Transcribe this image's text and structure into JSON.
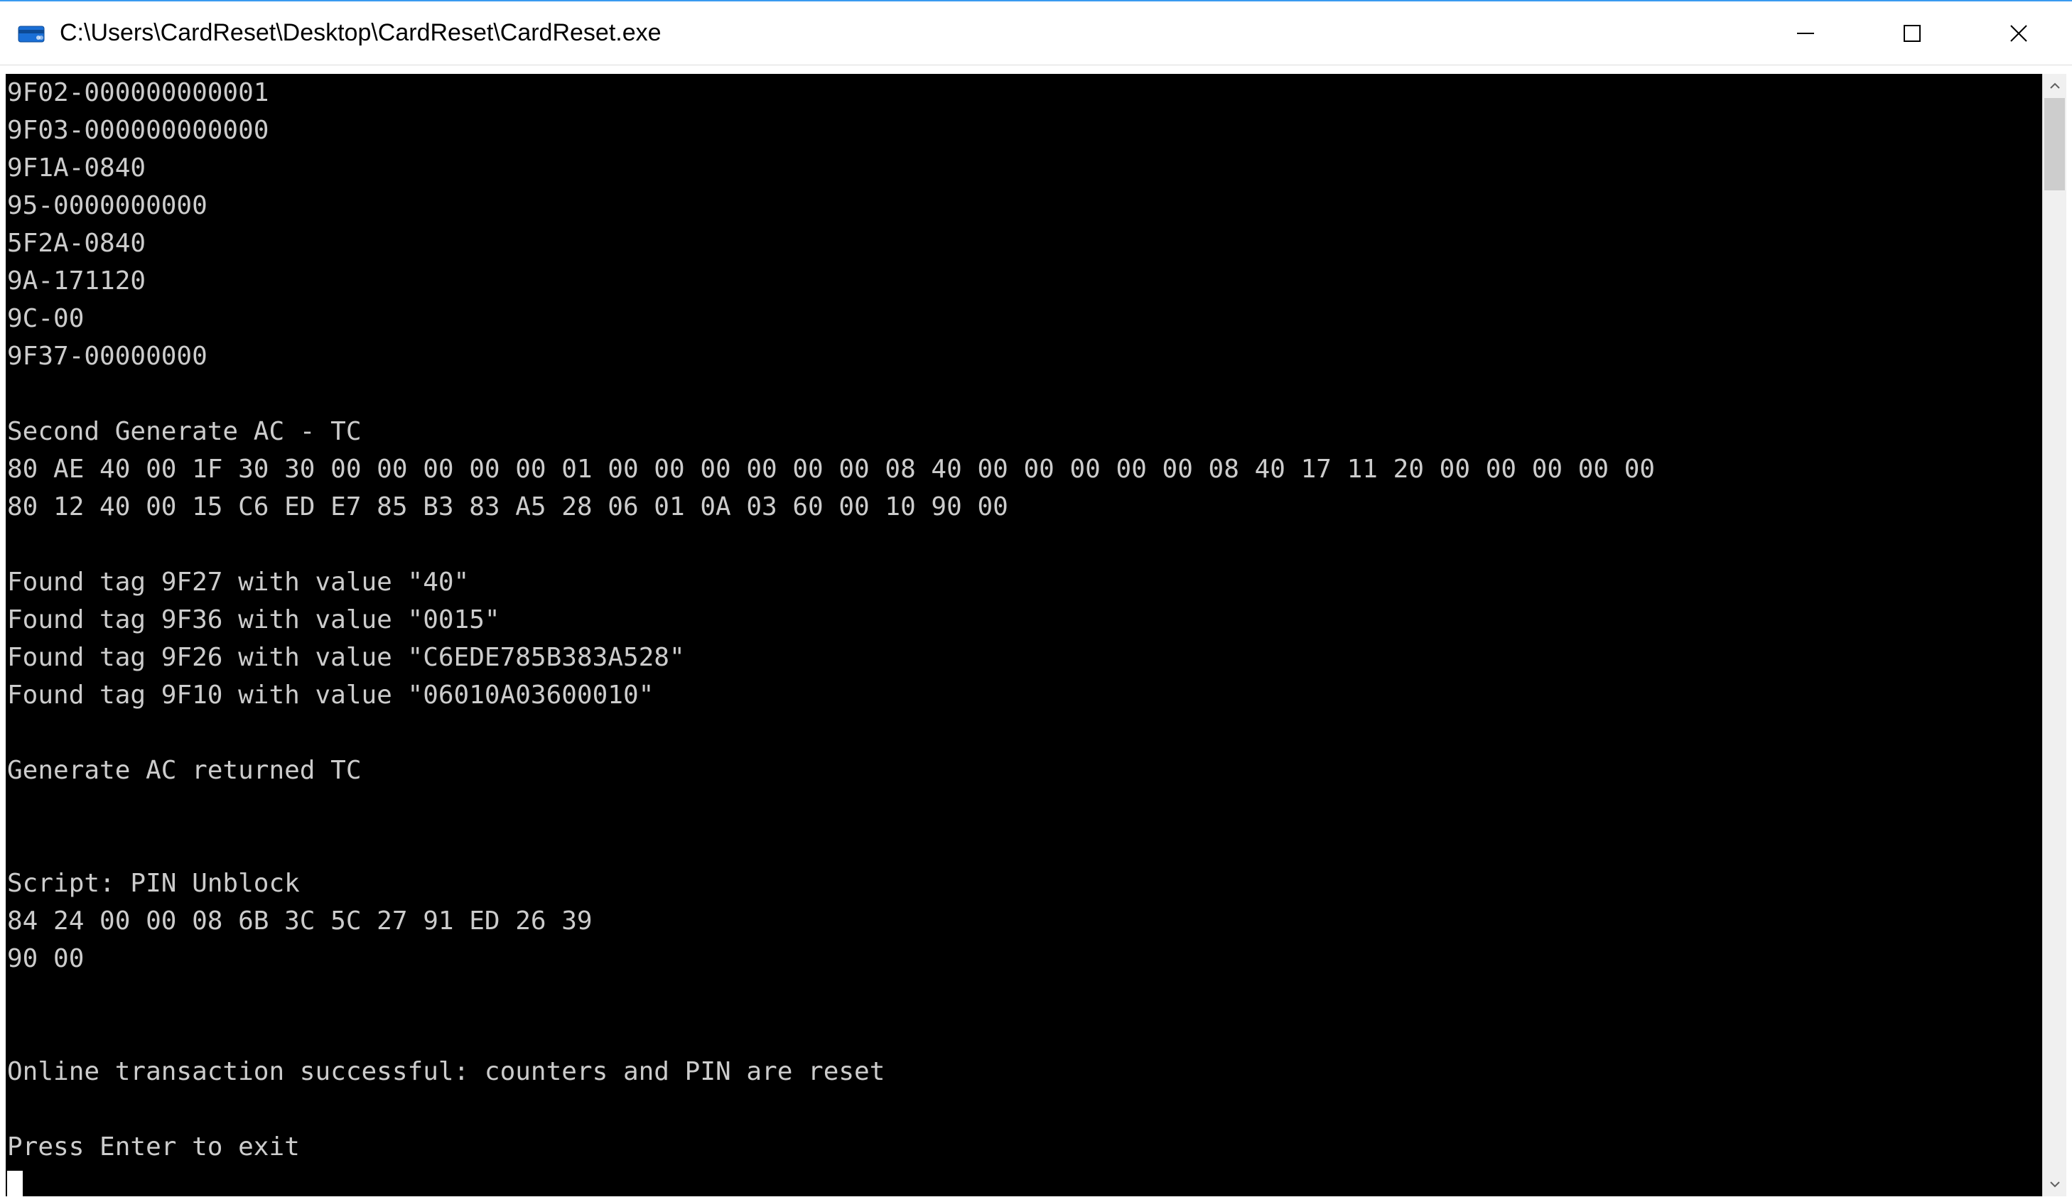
{
  "window": {
    "title": "C:\\Users\\CardReset\\Desktop\\CardReset\\CardReset.exe"
  },
  "console": {
    "lines": [
      "9F02-000000000001",
      "9F03-000000000000",
      "9F1A-0840",
      "95-0000000000",
      "5F2A-0840",
      "9A-171120",
      "9C-00",
      "9F37-00000000",
      "",
      "Second Generate AC - TC",
      "80 AE 40 00 1F 30 30 00 00 00 00 00 01 00 00 00 00 00 00 08 40 00 00 00 00 00 08 40 17 11 20 00 00 00 00 00",
      "80 12 40 00 15 C6 ED E7 85 B3 83 A5 28 06 01 0A 03 60 00 10 90 00",
      "",
      "Found tag 9F27 with value \"40\"",
      "Found tag 9F36 with value \"0015\"",
      "Found tag 9F26 with value \"C6EDE785B383A528\"",
      "Found tag 9F10 with value \"06010A03600010\"",
      "",
      "Generate AC returned TC",
      "",
      "",
      "Script: PIN Unblock",
      "84 24 00 00 08 6B 3C 5C 27 91 ED 26 39",
      "90 00",
      "",
      "",
      "Online transaction successful: counters and PIN are reset",
      "",
      "Press Enter to exit"
    ]
  }
}
